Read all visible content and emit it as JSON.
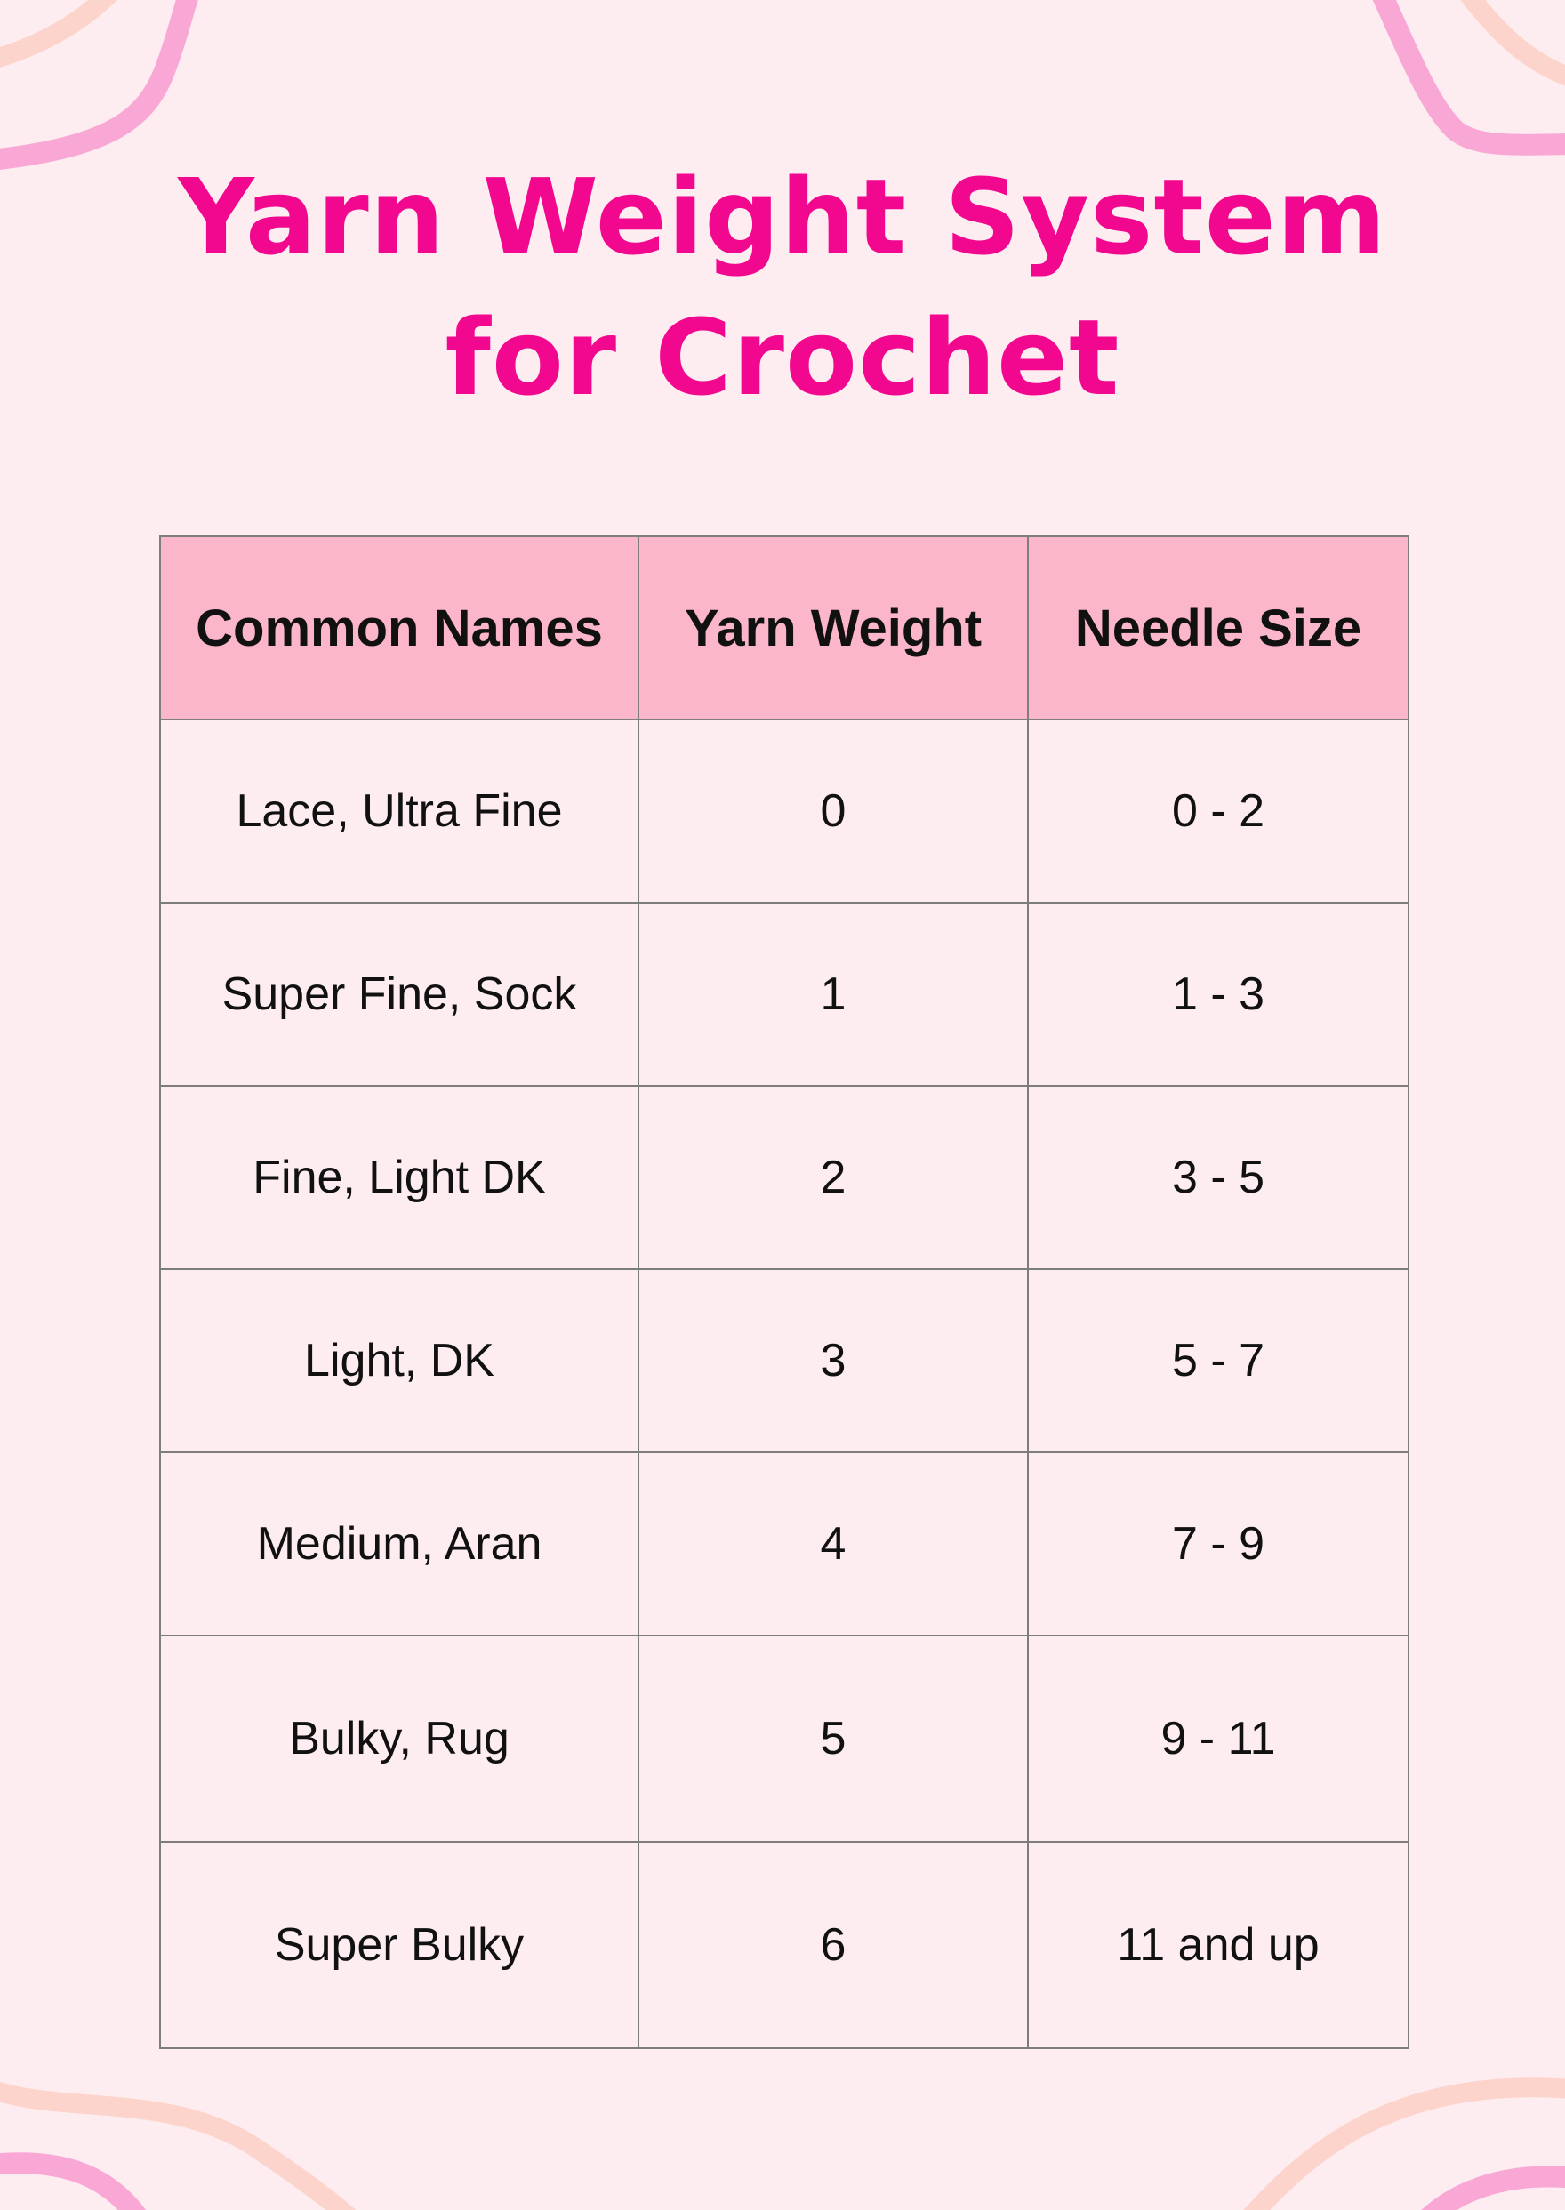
{
  "title": {
    "line1": "Yarn Weight System",
    "line2": "for Crochet"
  },
  "colors": {
    "background": "#fdedf0",
    "title": "#f2088f",
    "header_fill": "#fbb7c9",
    "decoration_pink": "#f9a8d6",
    "decoration_peach": "#fdd4cc"
  },
  "table": {
    "headers": [
      "Common Names",
      "Yarn Weight",
      "Needle Size"
    ],
    "rows": [
      [
        "Lace, Ultra Fine",
        "0",
        "0 - 2"
      ],
      [
        "Super Fine, Sock",
        "1",
        "1 - 3"
      ],
      [
        "Fine, Light DK",
        "2",
        "3 - 5"
      ],
      [
        "Light, DK",
        "3",
        "5 - 7"
      ],
      [
        "Medium, Aran",
        "4",
        "7 - 9"
      ],
      [
        "Bulky, Rug",
        "5",
        "9 - 11"
      ],
      [
        "Super Bulky",
        "6",
        "11 and up"
      ]
    ]
  }
}
